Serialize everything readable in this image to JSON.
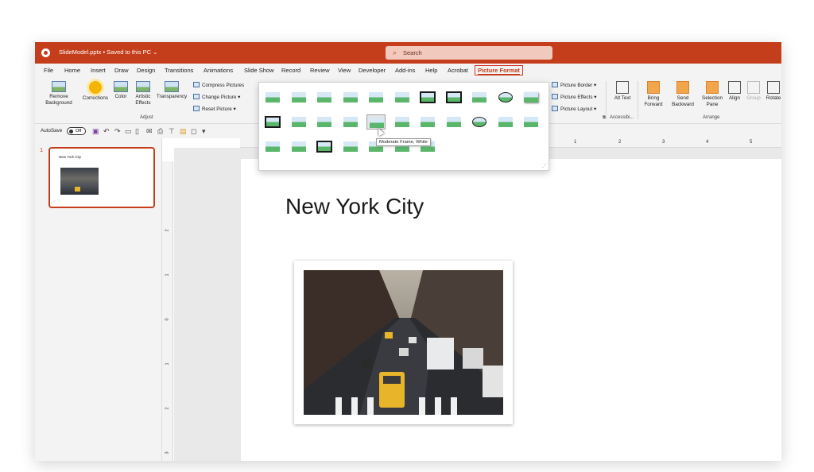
{
  "titlebar": {
    "doc_title": "SlideModel.pptx • Saved to this PC ⌄",
    "search_placeholder": "Search"
  },
  "tabs": [
    "File",
    "Home",
    "Insert",
    "Draw",
    "Design",
    "Transitions",
    "Animations",
    "Slide Show",
    "Record",
    "Review",
    "View",
    "Developer",
    "Add-ins",
    "Help",
    "Acrobat",
    "Picture Format"
  ],
  "ribbon": {
    "adjust": {
      "remove_background": "Remove Background",
      "corrections": "Corrections",
      "color": "Color",
      "artistic_effects": "Artistic Effects",
      "transparency": "Transparency",
      "compress": "Compress Pictures",
      "change_picture": "Change Picture",
      "reset_picture": "Reset Picture",
      "group_label": "Adjust"
    },
    "styles": {
      "picture_border": "Picture Border",
      "picture_effects": "Picture Effects",
      "picture_layout": "Picture Layout"
    },
    "accessibility": {
      "alt_text": "Alt Text",
      "group_label": "Accessibi..."
    },
    "arrange": {
      "bring_forward": "Bring Forward",
      "send_backward": "Send Backward",
      "selection_pane": "Selection Pane",
      "align": "Align",
      "group": "Group",
      "rotate": "Rotate",
      "group_label": "Arrange"
    }
  },
  "qat": {
    "autosave_label": "AutoSave",
    "autosave_state": "Off"
  },
  "gallery": {
    "tooltip": "Moderate Frame, White",
    "selected_index": 15,
    "styles_count": 29
  },
  "slides_panel": {
    "slide_number": "1",
    "thumb_title": "New York City"
  },
  "slide": {
    "title": "New York City"
  },
  "hruler_labels": [
    "1",
    "2",
    "3",
    "4",
    "5"
  ],
  "vruler_labels": [
    "2",
    "1",
    "0",
    "1",
    "2",
    "3"
  ],
  "colors": {
    "accent": "#c43e1c",
    "ribbon_bg": "#f3f3f3"
  }
}
